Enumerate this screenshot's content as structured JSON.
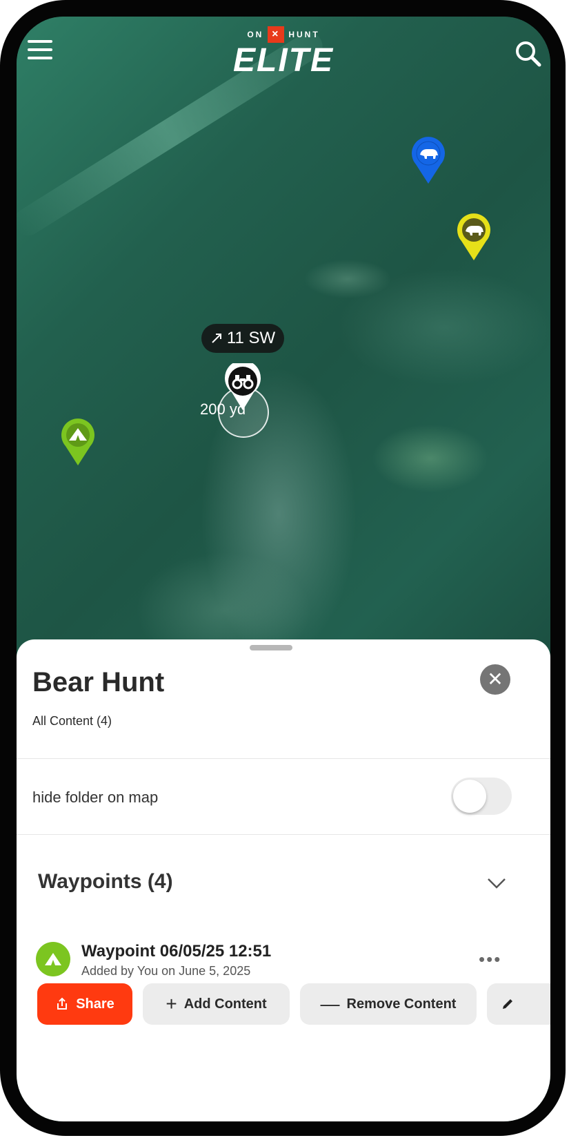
{
  "app": {
    "brand_small_left": "ON",
    "brand_small_x": "×",
    "brand_small_right": "HUNT",
    "brand_big": "ELITE"
  },
  "map": {
    "distance_label": "11 SW",
    "range_label": "200 yd",
    "pins": [
      {
        "kind": "bear",
        "color": "#1466e6"
      },
      {
        "kind": "bear",
        "color": "#e6e019"
      },
      {
        "kind": "camp",
        "color": "#7cc520"
      },
      {
        "kind": "binoculars",
        "color": "#111111"
      }
    ]
  },
  "sheet": {
    "title": "Bear Hunt",
    "subtitle": "All Content (4)",
    "hide_label": "hide folder on map",
    "hide_enabled": false,
    "section_title": "Waypoints  (4)",
    "waypoints": [
      {
        "title": "Waypoint 06/05/25 12:51",
        "subtitle": "Added by You on June 5, 2025"
      }
    ]
  },
  "toolbar": {
    "share": "Share",
    "add_content": "Add Content",
    "remove_content": "Remove Content"
  },
  "colors": {
    "accent": "#ff3a10",
    "toggle_off": "#ececec",
    "camp_green": "#7cc520"
  }
}
